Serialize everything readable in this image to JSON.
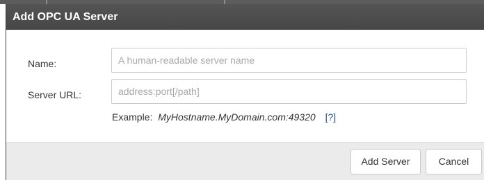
{
  "dialog": {
    "title": "Add OPC UA Server"
  },
  "form": {
    "name_label": "Name:",
    "name_placeholder": "A human-readable server name",
    "name_value": "",
    "url_label": "Server URL:",
    "url_placeholder": "address:port[/path]",
    "url_value": "",
    "example_label": "Example:",
    "example_value": "MyHostname.MyDomain.com:49320",
    "help_link": "[?]"
  },
  "footer": {
    "add_label": "Add Server",
    "cancel_label": "Cancel"
  },
  "colors": {
    "titlebar": "#4b4b4b",
    "footer": "#ebebeb",
    "link": "#1a4e8a"
  }
}
